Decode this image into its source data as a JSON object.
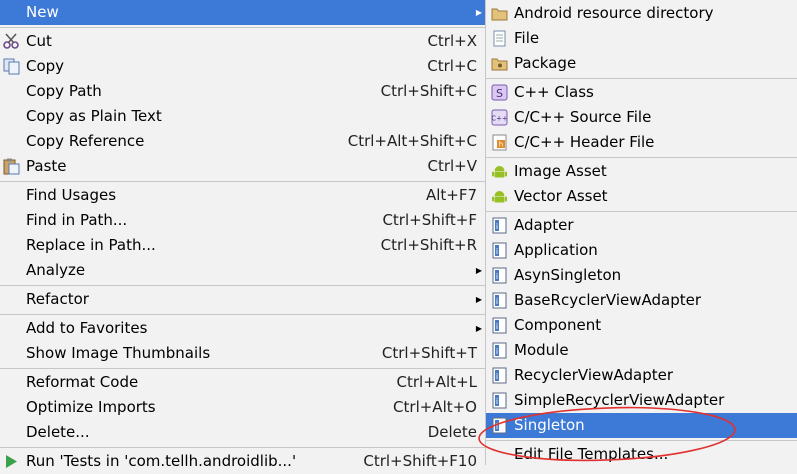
{
  "main_menu": {
    "items": [
      {
        "label": "New",
        "shortcut": "",
        "has_submenu": true,
        "selected": true
      },
      {
        "label": "Cut",
        "shortcut": "Ctrl+X",
        "icon": "scissors-icon"
      },
      {
        "label": "Copy",
        "shortcut": "Ctrl+C",
        "icon": "copy-icon"
      },
      {
        "label": "Copy Path",
        "shortcut": "Ctrl+Shift+C"
      },
      {
        "label": "Copy as Plain Text",
        "shortcut": ""
      },
      {
        "label": "Copy Reference",
        "shortcut": "Ctrl+Alt+Shift+C"
      },
      {
        "label": "Paste",
        "shortcut": "Ctrl+V",
        "icon": "paste-icon"
      },
      {
        "label": "Find Usages",
        "shortcut": "Alt+F7"
      },
      {
        "label": "Find in Path...",
        "shortcut": "Ctrl+Shift+F"
      },
      {
        "label": "Replace in Path...",
        "shortcut": "Ctrl+Shift+R"
      },
      {
        "label": "Analyze",
        "shortcut": "",
        "has_submenu": true
      },
      {
        "label": "Refactor",
        "shortcut": "",
        "has_submenu": true
      },
      {
        "label": "Add to Favorites",
        "shortcut": "",
        "has_submenu": true
      },
      {
        "label": "Show Image Thumbnails",
        "shortcut": "Ctrl+Shift+T"
      },
      {
        "label": "Reformat Code",
        "shortcut": "Ctrl+Alt+L"
      },
      {
        "label": "Optimize Imports",
        "shortcut": "Ctrl+Alt+O"
      },
      {
        "label": "Delete...",
        "shortcut": "Delete"
      },
      {
        "label": "Run 'Tests in 'com.tellh.androidlib...'",
        "shortcut": "Ctrl+Shift+F10",
        "icon": "run-icon"
      }
    ]
  },
  "sub_menu": {
    "items": [
      {
        "label": "Android resource directory",
        "icon": "folder-icon"
      },
      {
        "label": "File",
        "icon": "file-icon"
      },
      {
        "label": "Package",
        "icon": "package-icon"
      },
      {
        "label": "C++ Class",
        "icon": "cpp-class-icon"
      },
      {
        "label": "C/C++ Source File",
        "icon": "cpp-source-icon"
      },
      {
        "label": "C/C++ Header File",
        "icon": "cpp-header-icon"
      },
      {
        "label": "Image Asset",
        "icon": "android-icon"
      },
      {
        "label": "Vector Asset",
        "icon": "android-icon"
      },
      {
        "label": "Adapter",
        "icon": "template-icon"
      },
      {
        "label": "Application",
        "icon": "template-icon"
      },
      {
        "label": "AsynSingleton",
        "icon": "template-icon"
      },
      {
        "label": "BaseRcyclerViewAdapter",
        "icon": "template-icon"
      },
      {
        "label": "Component",
        "icon": "template-icon"
      },
      {
        "label": "Module",
        "icon": "template-icon"
      },
      {
        "label": "RecyclerViewAdapter",
        "icon": "template-icon"
      },
      {
        "label": "SimpleRecyclerViewAdapter",
        "icon": "template-icon"
      },
      {
        "label": "Singleton",
        "icon": "template-icon",
        "selected": true
      },
      {
        "label": "Edit File Templates...",
        "icon": ""
      }
    ]
  },
  "colors": {
    "selection": "#3d7ad7",
    "background": "#f2f2f2",
    "annotation": "#e0312f"
  }
}
